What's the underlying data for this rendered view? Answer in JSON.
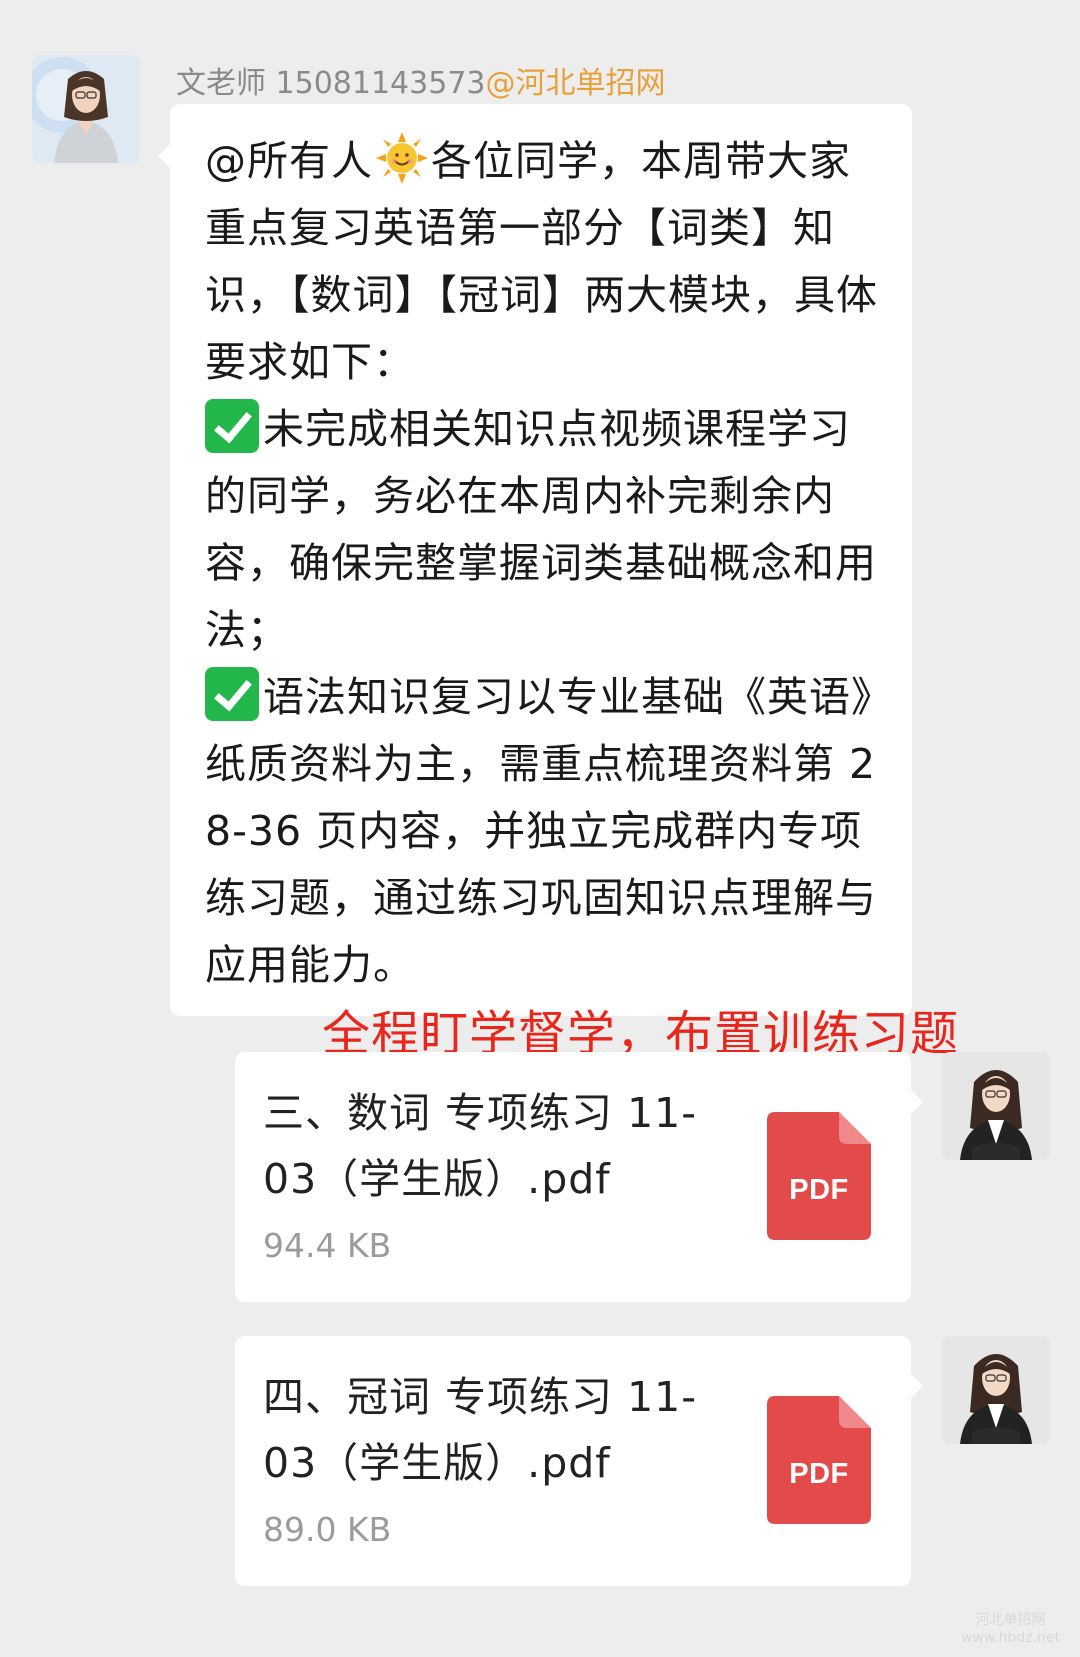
{
  "sender": {
    "name": "文老师 15081143573",
    "site": "@河北单招网"
  },
  "message": {
    "p1_before_emoji": "@所有人",
    "p1_after_emoji": "各位同学，本周带大家重点复习英语第一部分【词类】知识，【数词】【冠词】两大模块，具体要求如下：",
    "p2": "未完成相关知识点视频课程学习的同学，务必在本周内补完剩余内容，确保完整掌握词类基础概念和用法；",
    "p3": "语法知识复习以专业基础《英语》纸质资料为主，需重点梳理资料第 28-36 页内容，并独立完成群内专项练习题，通过练习巩固知识点理解与应用能力。"
  },
  "annotation": "全程盯学督学，布置训练习题",
  "files": [
    {
      "name": "三、数词 专项练习 11-03（学生版）.pdf",
      "size": "94.4 KB",
      "icon_label": "PDF"
    },
    {
      "name": "四、冠词 专项练习 11-03（学生版）.pdf",
      "size": "89.0 KB",
      "icon_label": "PDF"
    }
  ],
  "watermark": {
    "line1": "河北单招网",
    "line2": "www.hbdz.net"
  },
  "colors": {
    "background": "#ededed",
    "bubble": "#ffffff",
    "annotation": "#e8261c",
    "pdf_red": "#e34a4a",
    "check_green": "#22b64b",
    "site_orange": "#e8a13a"
  }
}
